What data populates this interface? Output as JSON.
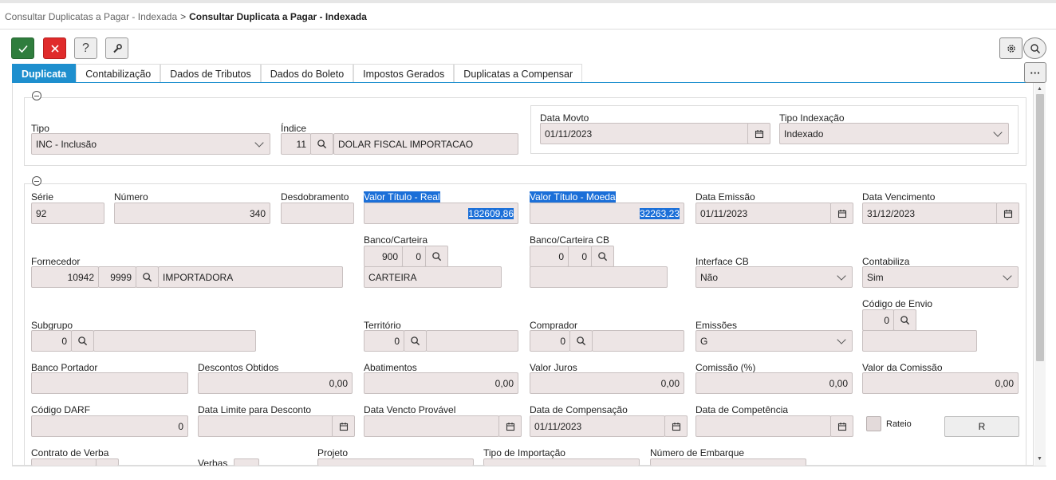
{
  "breadcrumb": {
    "parent": "Consultar Duplicatas a Pagar - Indexada",
    "separator": ">",
    "current": "Consultar Duplicata a Pagar - Indexada"
  },
  "toolbar": {
    "help": "?"
  },
  "tabs": [
    "Duplicata",
    "Contabilização",
    "Dados de Tributos",
    "Dados do Boleto",
    "Impostos Gerados",
    "Duplicatas a Compensar"
  ],
  "more": "···",
  "s1": {
    "tipo_label": "Tipo",
    "tipo_value": "INC - Inclusão",
    "indice_label": "Índice",
    "indice_code": "11",
    "indice_desc": "DOLAR FISCAL IMPORTACAO",
    "data_movto_label": "Data Movto",
    "data_movto": "01/11/2023",
    "tipo_index_label": "Tipo Indexação",
    "tipo_index": "Indexado"
  },
  "s2": {
    "serie_label": "Série",
    "serie": "92",
    "numero_label": "Número",
    "numero": "340",
    "desdobramento_label": "Desdobramento",
    "desdobramento": "",
    "vt_real_label": "Valor Título - Real",
    "vt_real": "182609,86",
    "vt_moeda_label": "Valor Título - Moeda",
    "vt_moeda": "32263,23",
    "data_emissao_label": "Data Emissão",
    "data_emissao": "01/11/2023",
    "data_venc_label": "Data Vencimento",
    "data_venc": "31/12/2023",
    "fornecedor_label": "Fornecedor",
    "forn_code": "10942",
    "forn_sub": "9999",
    "forn_name": "IMPORTADORA",
    "banco_label": "Banco/Carteira",
    "banco": "900",
    "banco_sub": "0",
    "banco_name": "CARTEIRA",
    "bancocb_label": "Banco/Carteira CB",
    "bancocb": "0",
    "bancocb_sub": "0",
    "interface_label": "Interface CB",
    "interface": "Não",
    "contabiliza_label": "Contabiliza",
    "contabiliza": "Sim",
    "cod_envio_label": "Código de Envio",
    "cod_envio": "0",
    "subgrupo_label": "Subgrupo",
    "subgrupo": "0",
    "territorio_label": "Território",
    "territorio": "0",
    "comprador_label": "Comprador",
    "comprador": "0",
    "emissoes_label": "Emissões",
    "emissoes": "G",
    "banco_port_label": "Banco Portador",
    "desc_obt_label": "Descontos Obtidos",
    "desc_obt": "0,00",
    "abatimentos_label": "Abatimentos",
    "abatimentos": "0,00",
    "juros_label": "Valor Juros",
    "juros": "0,00",
    "comissao_label": "Comissão (%)",
    "comissao": "0,00",
    "val_comissao_label": "Valor da Comissão",
    "val_comissao": "0,00",
    "darf_label": "Código DARF",
    "darf": "0",
    "dl_desconto_label": "Data Limite para Desconto",
    "dv_provavel_label": "Data Vencto Provável",
    "dt_comp_label": "Data de Compensação",
    "dt_comp": "01/11/2023",
    "dt_competencia_label": "Data de Competência",
    "rateio_label": "Rateio",
    "rateio_btn": "R",
    "contrato_label": "Contrato de Verba",
    "verbas_label": "Verbas",
    "projeto_label": "Projeto",
    "tipo_import_label": "Tipo de Importação",
    "num_embarque_label": "Número de Embarque"
  }
}
